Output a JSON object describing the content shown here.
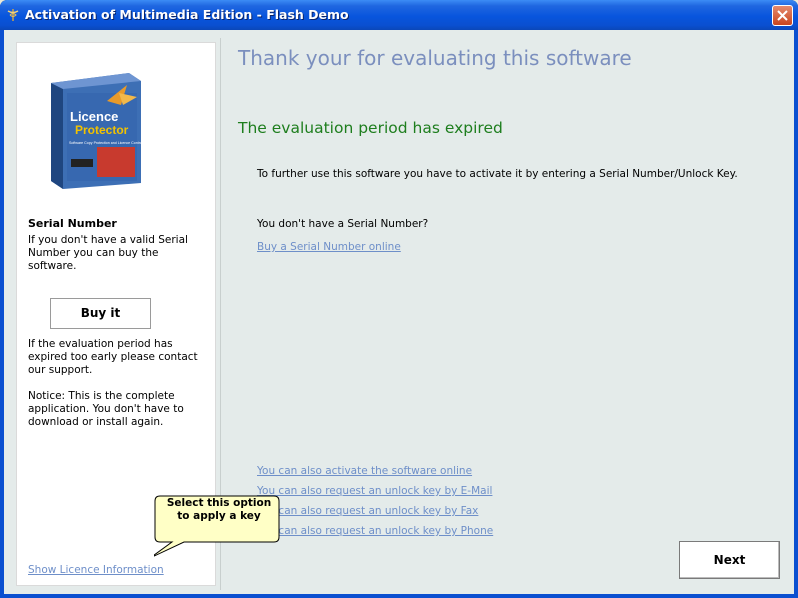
{
  "window": {
    "title": "Activation of Multimedia Edition - Flash Demo"
  },
  "sidebar": {
    "product_box": {
      "brand_line1": "Licence",
      "brand_line2": "Protector",
      "tagline": "Software Copy Protection and Licence Control"
    },
    "serial_heading": "Serial Number",
    "serial_text": "If you don't have a valid Serial Number you can buy the software.",
    "buy_label": "Buy it",
    "expired_text": "If the evaluation period has expired too early please contact our support.",
    "notice_text": "Notice: This is the complete application. You don't have to download or install again.",
    "show_licence_link": "Show Licence Information"
  },
  "main": {
    "headline": "Thank your for evaluating this software",
    "status": "The evaluation period has expired",
    "instruction": "To further use this software you have to activate it by entering a Serial Number/Unlock Key.",
    "no_serial_question": "You don't have a Serial Number?",
    "buy_online_link": "Buy a Serial Number online",
    "options": [
      "You can also activate the software online",
      "You can also request an unlock key by E-Mail",
      "You can also request an unlock key by Fax",
      "You can also request an unlock key by Phone"
    ],
    "next_label": "Next"
  },
  "tooltip": {
    "text": "Select this option to apply a key"
  },
  "colors": {
    "titlebar": "#0855DD",
    "headline": "#7B8FBE",
    "status": "#1E7E1E",
    "link": "#6E8FC9",
    "client_bg": "#E4EBEA"
  }
}
